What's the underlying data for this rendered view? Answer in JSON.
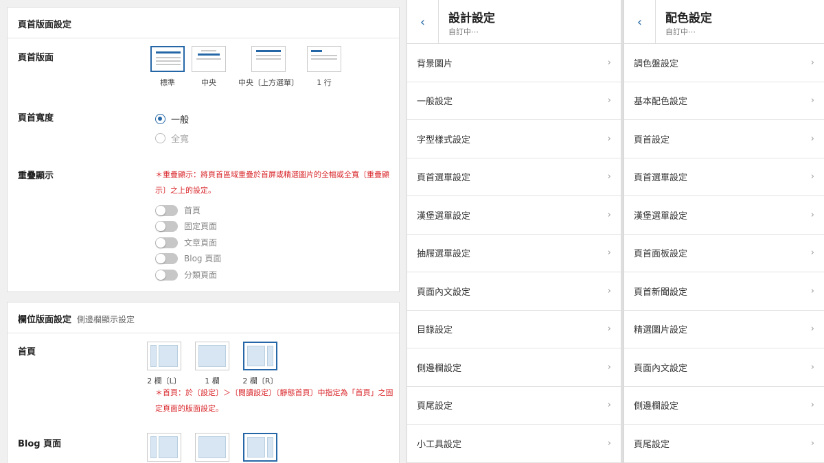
{
  "header_layout": {
    "title": "頁首版面設定",
    "layout_label": "頁首版面",
    "layout_options": [
      {
        "label": "標準",
        "selected": true
      },
      {
        "label": "中央",
        "selected": false
      },
      {
        "label": "中央〔上方選單〕",
        "selected": false
      },
      {
        "label": "1 行",
        "selected": false
      }
    ],
    "width_label": "頁首寬度",
    "width_options": [
      {
        "label": "一般",
        "checked": true
      },
      {
        "label": "全寬",
        "checked": false
      }
    ],
    "overlay_label": "重疊顯示",
    "overlay_note": "＊重疊顯示：將頁首區域重疊於首屏或精選圖片的全幅或全寬〔重疊顯示〕之上的設定。",
    "overlay_toggles": [
      "首頁",
      "固定頁面",
      "文章頁面",
      "Blog 頁面",
      "分類頁面"
    ]
  },
  "column_layout": {
    "title": "欄位版面設定",
    "subtitle": "側邊欄顯示設定",
    "home_label": "首頁",
    "home_options": [
      {
        "label": "2 欄〔L〕",
        "selected": false
      },
      {
        "label": "1 欄",
        "selected": false
      },
      {
        "label": "2 欄〔R〕",
        "selected": true
      }
    ],
    "home_note": "＊首頁：於〔設定〕＞〔閱讀設定〕〔靜態首頁〕中指定為「首頁」之固定頁面的版面設定。",
    "blog_label": "Blog 頁面"
  },
  "design_panel": {
    "title": "設計設定",
    "subtitle": "自訂中⋯",
    "items": [
      "背景圖片",
      "一般設定",
      "字型樣式設定",
      "頁首選單設定",
      "漢堡選單設定",
      "抽屜選單設定",
      "頁面內文設定",
      "目錄設定",
      "側邊欄設定",
      "頁尾設定",
      "小工具設定"
    ]
  },
  "color_panel": {
    "title": "配色設定",
    "subtitle": "自訂中⋯",
    "items": [
      "調色盤設定",
      "基本配色設定",
      "頁首設定",
      "頁首選單設定",
      "漢堡選單設定",
      "頁首面板設定",
      "頁首新聞設定",
      "精選圖片設定",
      "頁面內文設定",
      "側邊欄設定",
      "頁尾設定"
    ]
  },
  "icons": {
    "back": "chevron-left-icon",
    "forward": "chevron-right-icon"
  },
  "colors": {
    "accent": "#2567a6",
    "note": "#d9262a"
  }
}
